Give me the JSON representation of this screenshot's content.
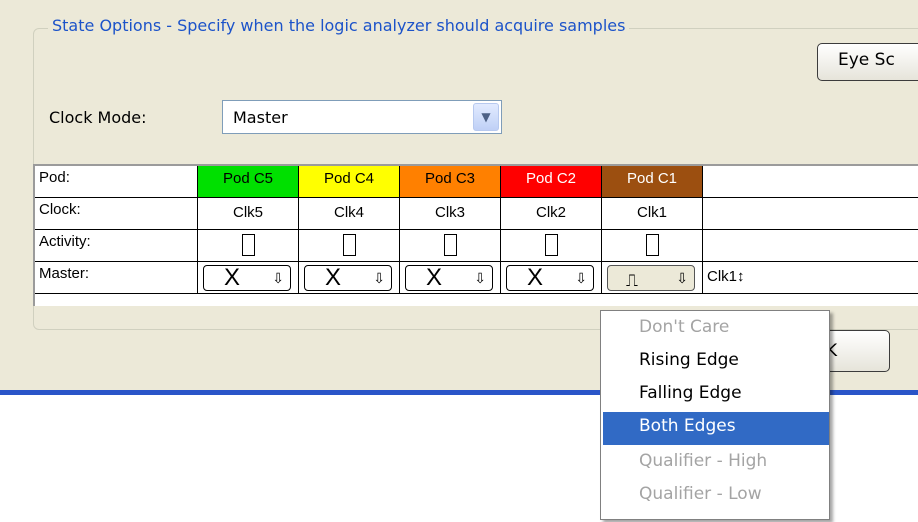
{
  "groupbox": {
    "title": "State Options - Specify when the logic analyzer should acquire samples"
  },
  "eye_button": {
    "label": "Eye Sc"
  },
  "clock_mode": {
    "label": "Clock Mode:",
    "value": "Master",
    "dropdown_icon": "chevron-down-icon"
  },
  "grid": {
    "row_labels": {
      "pod": "Pod:",
      "clock": "Clock:",
      "activity": "Activity:",
      "master": "Master:"
    },
    "pods": [
      {
        "name": "Pod C5",
        "clock": "Clk5",
        "color": "#00e000",
        "text_color": "#000000",
        "master_symbol": "X"
      },
      {
        "name": "Pod C4",
        "clock": "Clk4",
        "color": "#ffff00",
        "text_color": "#000000",
        "master_symbol": "X"
      },
      {
        "name": "Pod C3",
        "clock": "Clk3",
        "color": "#ff8000",
        "text_color": "#000000",
        "master_symbol": "X"
      },
      {
        "name": "Pod C2",
        "clock": "Clk2",
        "color": "#ff0000",
        "text_color": "#ffffff",
        "master_symbol": "X"
      },
      {
        "name": "Pod C1",
        "clock": "Clk1",
        "color": "#9c4f10",
        "text_color": "#ffffff",
        "master_symbol": "⎍"
      }
    ],
    "master_summary": "Clk1↕"
  },
  "ok_button": {
    "label": "K"
  },
  "menu": {
    "items": [
      {
        "label": "Don't Care",
        "state": "disabled"
      },
      {
        "label": "Rising Edge",
        "state": "normal"
      },
      {
        "label": "Falling Edge",
        "state": "normal"
      },
      {
        "label": "Both Edges",
        "state": "highlighted"
      },
      {
        "label": "Qualifier - High",
        "state": "disabled"
      },
      {
        "label": "Qualifier - Low",
        "state": "disabled"
      }
    ]
  },
  "colors": {
    "dialog_bg": "#ece9d8",
    "title_blue": "#1c53c9",
    "highlight": "#316ac5"
  }
}
